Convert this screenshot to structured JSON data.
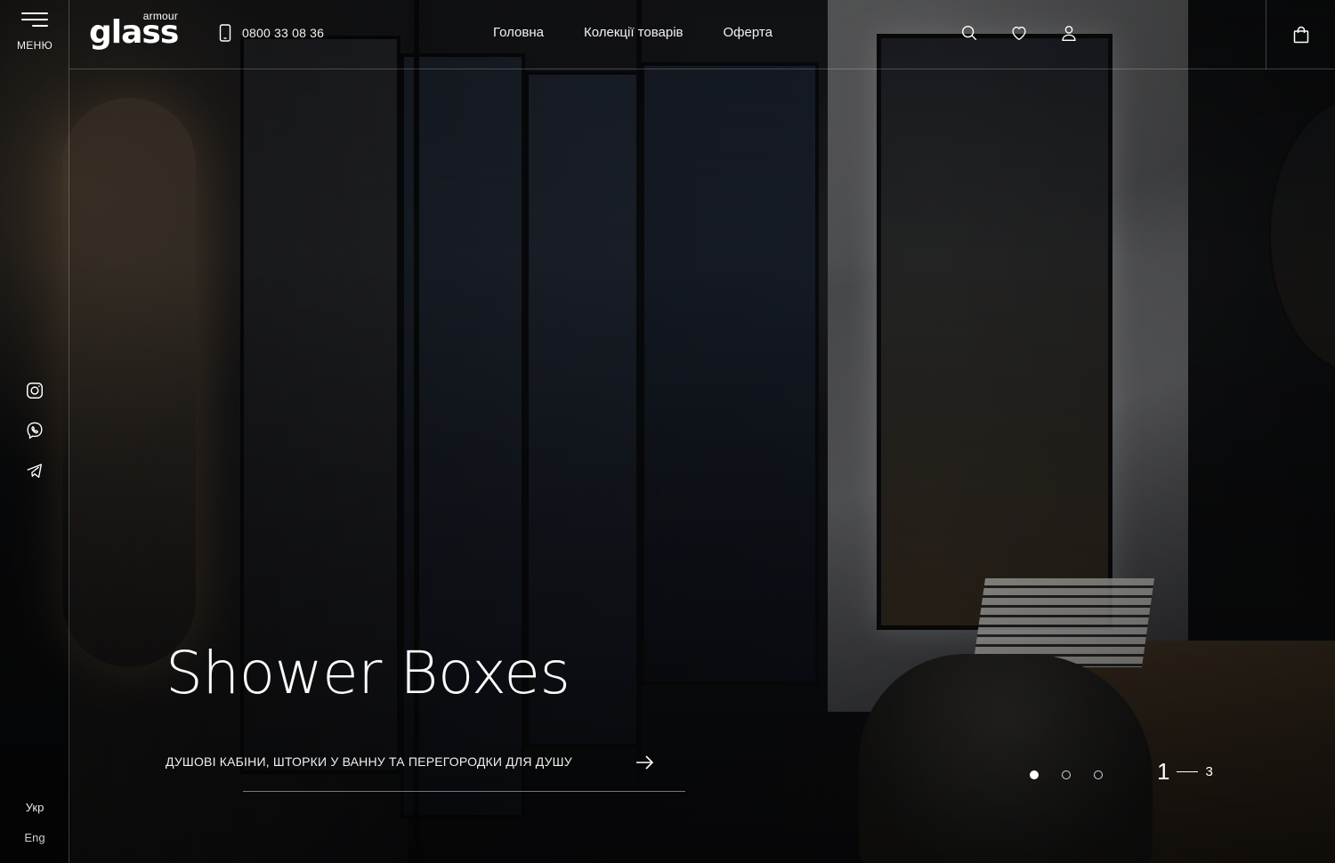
{
  "rail": {
    "menu_label": "МЕНЮ",
    "socials": [
      "instagram-icon",
      "viber-icon",
      "telegram-icon"
    ],
    "languages": [
      "Укр",
      "Eng"
    ]
  },
  "header": {
    "logo": {
      "top": "armour",
      "main": "glass"
    },
    "phone": "0800 33 08 36",
    "nav": [
      "Головна",
      "Колекції товарів",
      "Оферта"
    ],
    "icons": [
      "search-icon",
      "heart-icon",
      "user-icon",
      "cart-icon"
    ]
  },
  "hero": {
    "title": "Shower Boxes",
    "subtitle": "ДУШОВІ КАБІНИ, ШТОРКИ У ВАННУ ТА ПЕРЕГОРОДКИ ДЛЯ ДУШУ"
  },
  "slider": {
    "current": "1",
    "total": "3",
    "active_dot": 0,
    "dot_count": 3
  },
  "colors": {
    "text": "#ffffff",
    "background": "#0d0f12",
    "divider": "rgba(255,255,255,0.22)"
  }
}
